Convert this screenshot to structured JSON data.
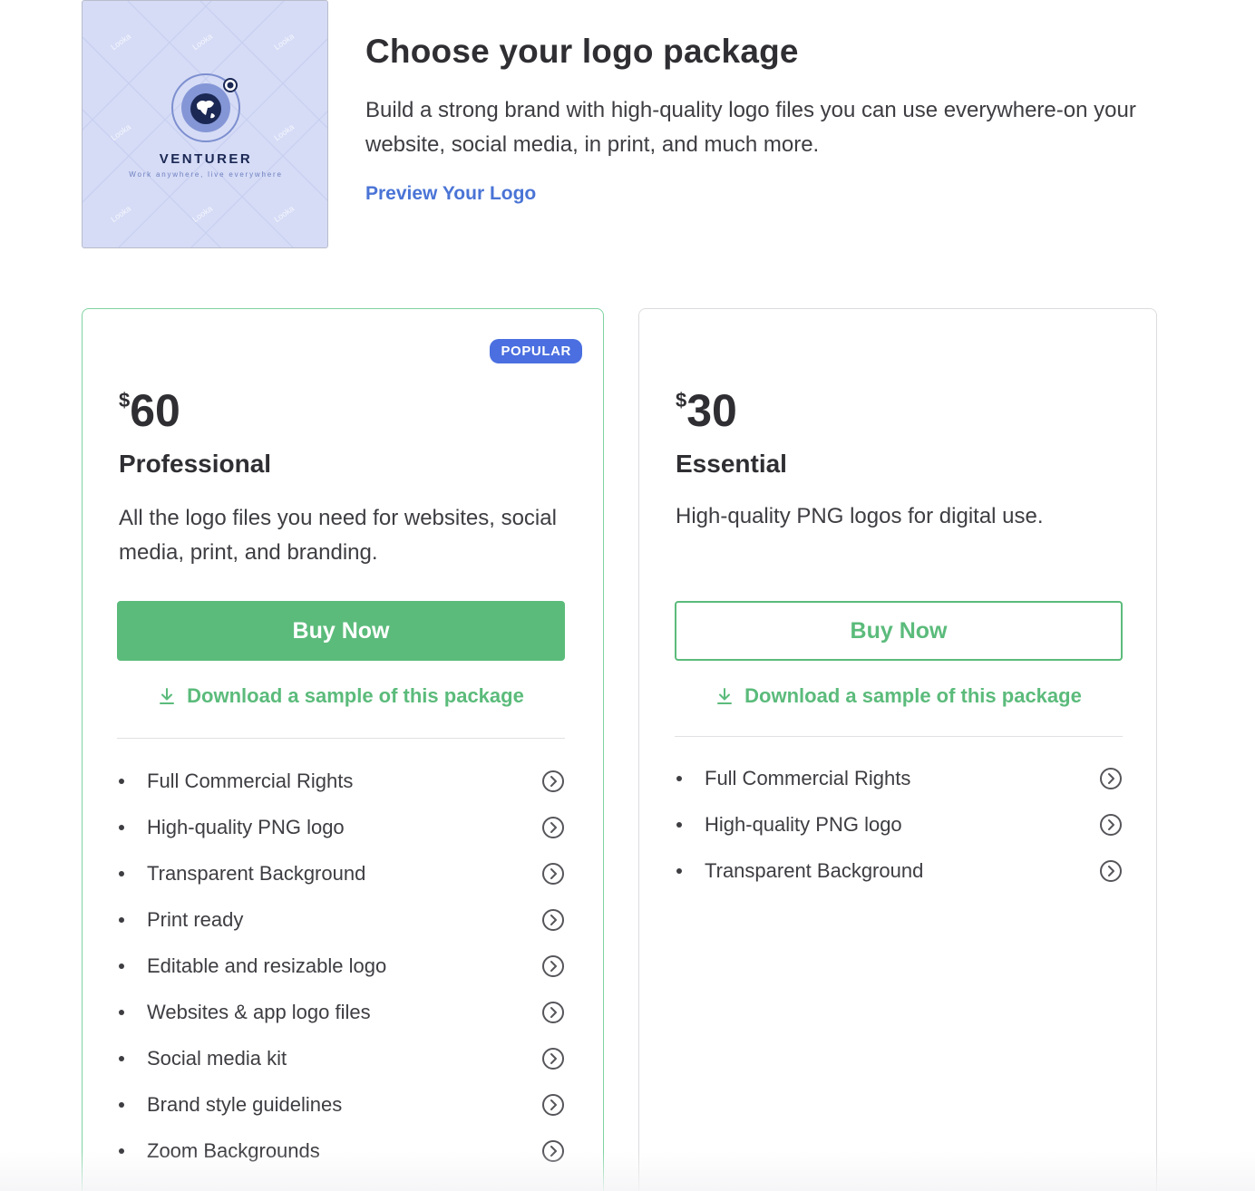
{
  "logo": {
    "brand_name": "VENTURER",
    "tagline": "Work anywhere, live everywhere",
    "watermark": "Looka",
    "colors": {
      "background": "#d6dcf6",
      "navy": "#1b2854",
      "accent": "#4a74d6"
    }
  },
  "header": {
    "title": "Choose your logo package",
    "subtitle": "Build a strong brand with high-quality logo files you can use everywhere-on your website, social media, in print, and much more.",
    "preview_link": "Preview Your Logo"
  },
  "packages": [
    {
      "badge": "POPULAR",
      "currency": "$",
      "price": "60",
      "name": "Professional",
      "description": "All the logo files you need for websites, social media, print, and branding.",
      "buy_label": "Buy Now",
      "sample_label": "Download a sample of this package",
      "features": [
        "Full Commercial Rights",
        "High-quality PNG logo",
        "Transparent Background",
        "Print ready",
        "Editable and resizable logo",
        "Websites & app logo files",
        "Social media kit",
        "Brand style guidelines",
        "Zoom Backgrounds"
      ]
    },
    {
      "currency": "$",
      "price": "30",
      "name": "Essential",
      "description": "High-quality PNG logos for digital use.",
      "buy_label": "Buy Now",
      "sample_label": "Download a sample of this package",
      "features": [
        "Full Commercial Rights",
        "High-quality PNG logo",
        "Transparent Background"
      ]
    }
  ],
  "icons": {
    "download": "download-icon",
    "feature_arrow": "chevron-right-circle-icon"
  },
  "colors": {
    "green": "#5bbb7b",
    "popular_blue": "#4b6fe0",
    "link_blue": "#4a74d6",
    "text": "#2f2f33"
  }
}
